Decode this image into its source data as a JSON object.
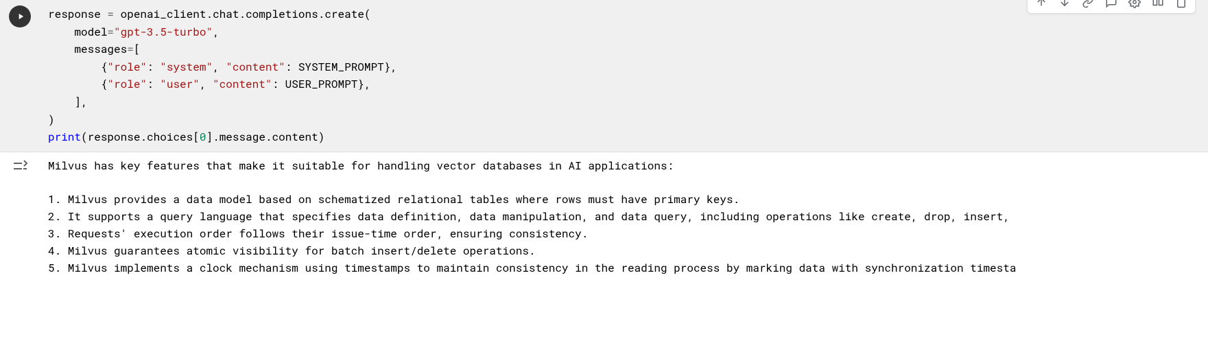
{
  "code": {
    "line1_id1": "response",
    "line1_eq": " = ",
    "line1_id2": "openai_client",
    "line1_dot1": ".",
    "line1_id3": "chat",
    "line1_dot2": ".",
    "line1_id4": "completions",
    "line1_dot3": ".",
    "line1_id5": "create",
    "line1_paren": "(",
    "line2_kw": "model",
    "line2_eq": "=",
    "line2_str": "\"gpt-3.5-turbo\"",
    "line2_comma": ",",
    "line3_kw": "messages",
    "line3_eq": "=",
    "line3_br": "[",
    "line4_open": "{",
    "line4_k1": "\"role\"",
    "line4_c1": ": ",
    "line4_v1": "\"system\"",
    "line4_comma1": ", ",
    "line4_k2": "\"content\"",
    "line4_c2": ": ",
    "line4_v2": "SYSTEM_PROMPT",
    "line4_close": "},",
    "line5_open": "{",
    "line5_k1": "\"role\"",
    "line5_c1": ": ",
    "line5_v1": "\"user\"",
    "line5_comma1": ", ",
    "line5_k2": "\"content\"",
    "line5_c2": ": ",
    "line5_v2": "USER_PROMPT",
    "line5_close": "},",
    "line6_br": "],",
    "line7_paren": ")",
    "line8_print": "print",
    "line8_open": "(",
    "line8_id1": "response",
    "line8_dot1": ".",
    "line8_id2": "choices",
    "line8_br1": "[",
    "line8_num": "0",
    "line8_br2": "]",
    "line8_dot2": ".",
    "line8_id3": "message",
    "line8_dot3": ".",
    "line8_id4": "content",
    "line8_close": ")"
  },
  "output": {
    "intro": "Milvus has key features that make it suitable for handling vector databases in AI applications:",
    "blank": "",
    "item1": "1. Milvus provides a data model based on schematized relational tables where rows must have primary keys.",
    "item2": "2. It supports a query language that specifies data definition, data manipulation, and data query, including operations like create, drop, insert,",
    "item3": "3. Requests' execution order follows their issue-time order, ensuring consistency.",
    "item4": "4. Milvus guarantees atomic visibility for batch insert/delete operations.",
    "item5": "5. Milvus implements a clock mechanism using timestamps to maintain consistency in the reading process by marking data with synchronization timesta"
  }
}
